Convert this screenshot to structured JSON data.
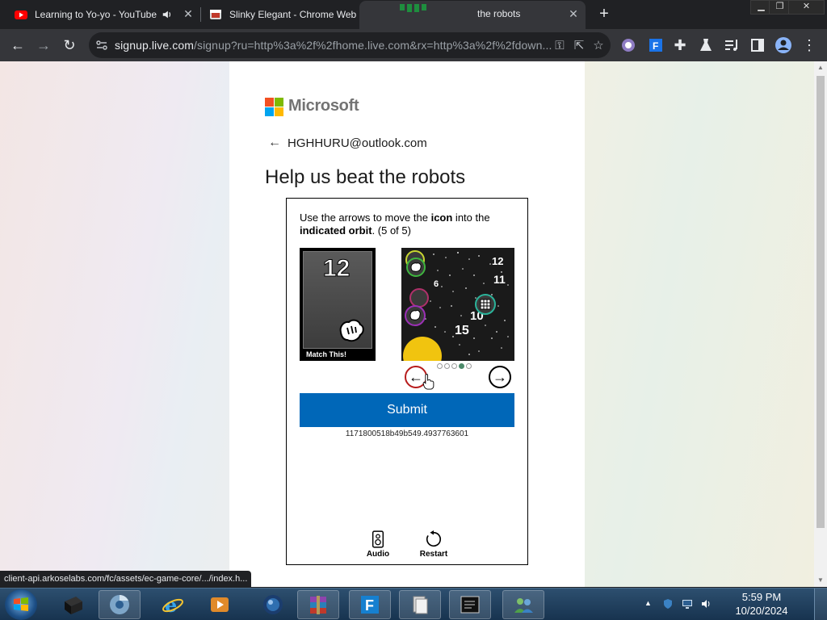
{
  "browser": {
    "tabs": [
      {
        "title": "Learning to Yo-yo - YouTube",
        "icon": "youtube-icon",
        "audio": true
      },
      {
        "title": "Slinky Elegant - Chrome Web",
        "icon": "web-store-icon"
      },
      {
        "title": "the robots",
        "icon": "microsoft-icon",
        "active": true
      }
    ],
    "url_host": "signup.live.com",
    "url_rest": "/signup?ru=http%3a%2f%2fhome.live.com&rx=http%3a%2f%2fdown...",
    "status_url": "client-api.arkoselabs.com/fc/assets/ec-game-core/.../index.h..."
  },
  "signup": {
    "brand": "Microsoft",
    "email": "HGHHURU@outlook.com",
    "heading": "Help us beat the robots",
    "instruction_prefix": "Use the arrows to move the ",
    "instruction_icon": "icon",
    "instruction_middle": " into the ",
    "instruction_orbit": "indicated orbit",
    "instruction_suffix": ". (5 of 5)",
    "match_number": "12",
    "match_label": "Match This!",
    "submit_label": "Submit",
    "session_id": "1171800518b49b549.4937763601",
    "audio_label": "Audio",
    "restart_label": "Restart",
    "dots_total": 5,
    "dots_active_index": 3
  },
  "galaxy": {
    "numbers": [
      "12",
      "11",
      "6",
      "10",
      "15"
    ]
  },
  "taskbar": {
    "time": "5:59 PM",
    "date": "10/20/2024"
  },
  "colors": {
    "ms_red": "#f25022",
    "ms_green": "#7fba00",
    "ms_blue": "#00a4ef",
    "ms_yellow": "#ffb900",
    "submit_blue": "#0067b8"
  }
}
